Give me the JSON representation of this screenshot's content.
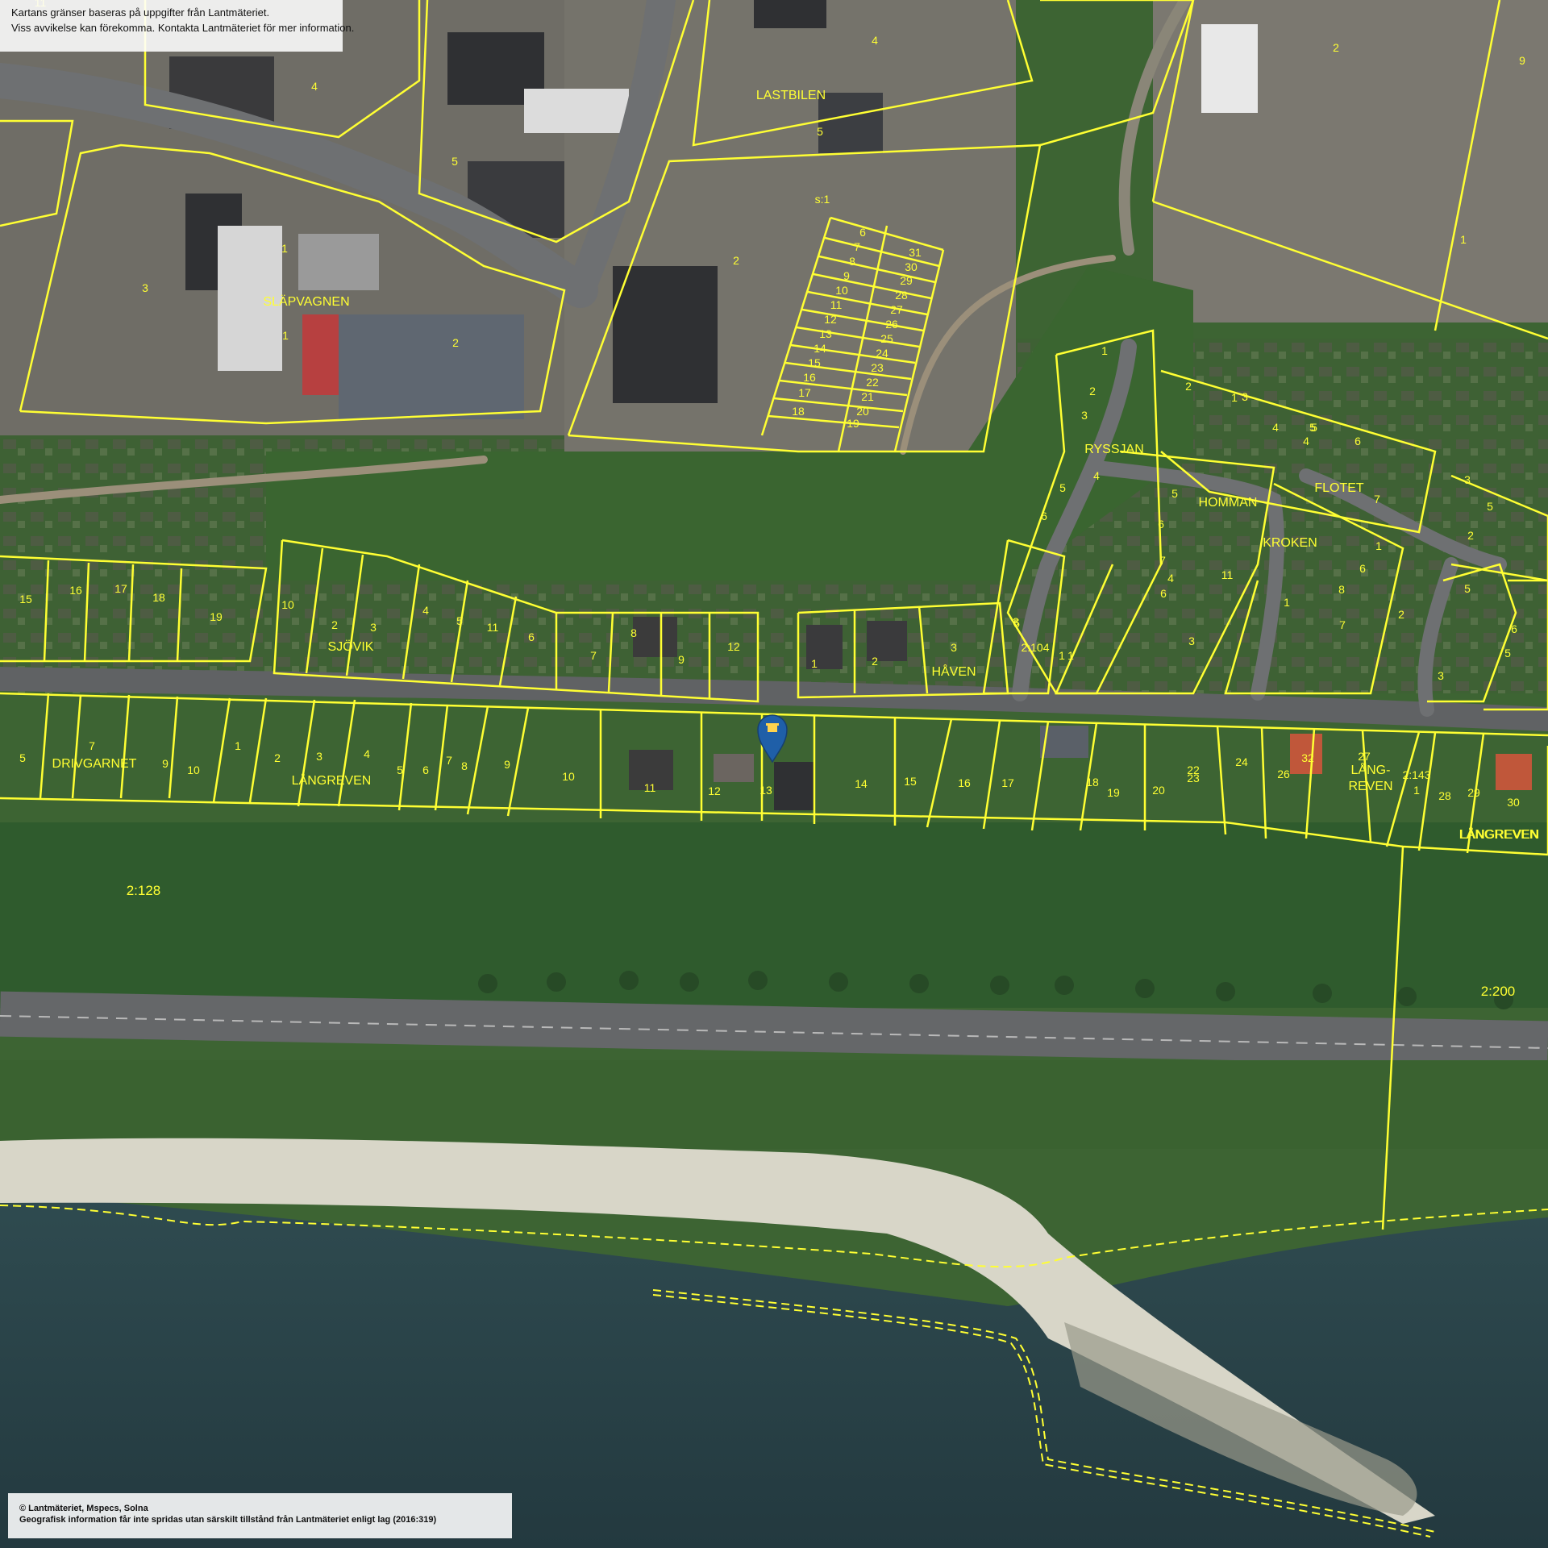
{
  "disclaimer": {
    "line1": "Kartans gränser baseras på uppgifter från Lantmäteriet.",
    "line2": "Viss avvikelse kan förekomma. Kontakta Lantmäteriet för mer information."
  },
  "copyright": {
    "line1": "© Lantmäteriet, Mspecs, Solna",
    "line2": "Geografisk information får inte spridas utan särskilt tillstånd från Lantmäteriet enligt lag (2016:319)"
  },
  "colors": {
    "boundary": "#ffff33",
    "marker": "#1f5fa8",
    "water": "#2c4a52",
    "beach": "#d8d6c8",
    "grass": "#3e6a32",
    "road": "#6e7072"
  },
  "marker": {
    "icon": "location-pin-icon"
  },
  "labels": {
    "area_names": [
      "LASTBILEN",
      "SLÄPVAGNEN",
      "RYSSJAN",
      "HOMMAN",
      "FLOTET",
      "KROKEN",
      "SJÖVIK",
      "HÅVEN",
      "DRIVGARNET",
      "LÅNGREVEN",
      "LÅNGREVEN",
      "LÅNG-",
      "REVEN",
      "LÅNGREVEN"
    ],
    "parcel_numbers_north": [
      "11",
      "4",
      "1",
      "2",
      "9",
      "4",
      "5",
      "5",
      "3",
      "1",
      "2",
      "2",
      "s:1",
      "6",
      "7",
      "8",
      "9",
      "10",
      "11",
      "12",
      "13",
      "14",
      "15",
      "16",
      "17",
      "18",
      "31",
      "30",
      "29",
      "28",
      "27",
      "26",
      "25",
      "24",
      "23",
      "22",
      "21",
      "20",
      "19",
      "1"
    ],
    "parcel_numbers_middle": [
      "1",
      "2",
      "3",
      "4",
      "5",
      "6",
      "5",
      "6",
      "4",
      "3",
      "2",
      "1",
      "3",
      "4",
      "5",
      "6",
      "7",
      "1",
      "7",
      "11",
      "6",
      "5",
      "4",
      "3",
      "8",
      "6",
      "1",
      "7",
      "2",
      "5",
      "6",
      "5",
      "3",
      "1",
      "2",
      "3",
      "5",
      "2:104",
      "1"
    ],
    "parcel_numbers_row_north": [
      "15",
      "16",
      "17",
      "18",
      "19",
      "10",
      "2",
      "3",
      "4",
      "5",
      "11",
      "6",
      "7",
      "8",
      "9",
      "12",
      "1",
      "2",
      "3",
      "5"
    ],
    "parcel_numbers_row_south": [
      "5",
      "7",
      "9",
      "10",
      "1",
      "2",
      "3",
      "4",
      "5",
      "6",
      "7",
      "8",
      "9",
      "10",
      "11",
      "12",
      "13",
      "14",
      "15",
      "16",
      "17",
      "18",
      "19",
      "20",
      "22",
      "23",
      "24",
      "26",
      "32",
      "27",
      "2:143",
      "1",
      "28",
      "29",
      "30"
    ],
    "property_ids": [
      "2:128",
      "2:200"
    ]
  }
}
